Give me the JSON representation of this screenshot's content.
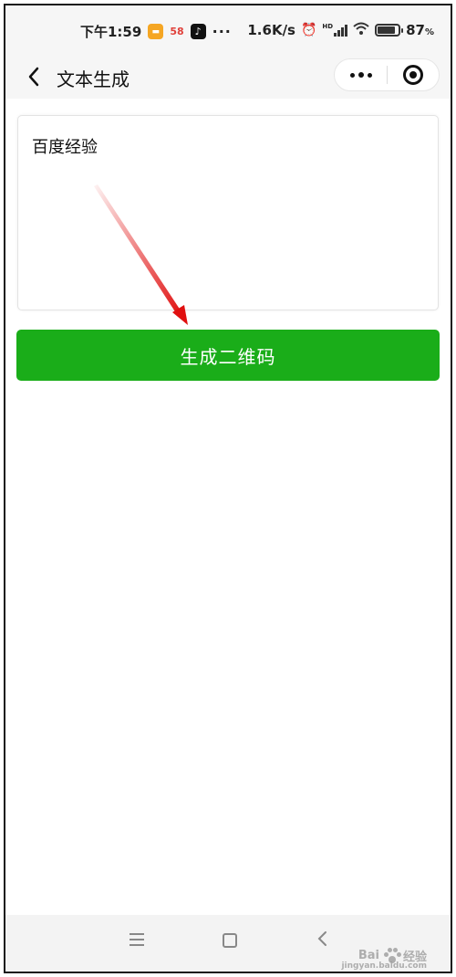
{
  "status_bar": {
    "time": "下午1:59",
    "app_58_label": "58",
    "more_notifications": "···",
    "network_speed": "1.6K/s",
    "signal_label": "HD",
    "battery_level": "87",
    "battery_unit": "%",
    "battery_fraction": 0.87
  },
  "nav_bar": {
    "title": "文本生成",
    "back_icon": "chevron-left-icon",
    "more_icon": "more-dots-icon",
    "close_icon": "target-circle-icon"
  },
  "form": {
    "text_value": "百度经验",
    "generate_button_label": "生成二维码"
  },
  "annotation": {
    "arrow_color": "#e01010"
  },
  "bottom_nav": {
    "menu_icon": "menu-icon",
    "home_icon": "square-home-icon",
    "back_icon": "back-triangle-icon"
  },
  "watermark": {
    "brand": "Bai",
    "brand_suffix": "经验",
    "url": "jingyan.baidu.com"
  },
  "colors": {
    "primary_green": "#1aad19",
    "bar_background": "#f6f6f6"
  }
}
